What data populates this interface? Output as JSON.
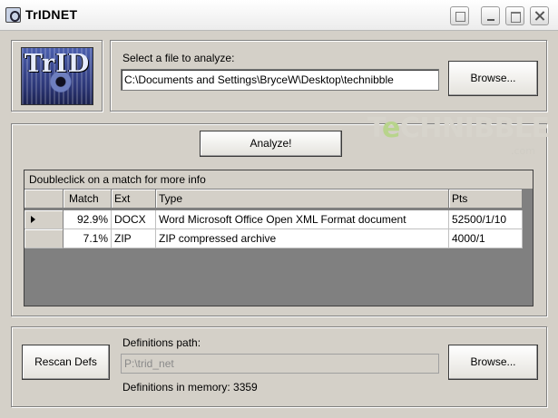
{
  "window": {
    "title": "TrIDNET"
  },
  "logo": {
    "text": "TrID"
  },
  "file": {
    "label": "Select a file to analyze:",
    "path": "C:\\Documents and Settings\\BryceW\\Desktop\\technibble",
    "browse_label": "Browse..."
  },
  "watermark": {
    "brand_prefix": "T",
    "brand_e": "e",
    "brand_rest": "CHNIBBLE",
    "suffix": ".com"
  },
  "analysis": {
    "analyze_label": "Analyze!",
    "caption": "Doubleclick on a match for more info",
    "columns": [
      "Match",
      "Ext",
      "Type",
      "Pts"
    ],
    "rows": [
      {
        "match": "92.9%",
        "ext": "DOCX",
        "type": "Word Microsoft Office Open XML Format document",
        "pts": "52500/1/10",
        "selected": true
      },
      {
        "match": "7.1%",
        "ext": "ZIP",
        "type": "ZIP compressed archive",
        "pts": "4000/1",
        "selected": false
      }
    ]
  },
  "definitions": {
    "rescan_label": "Rescan Defs",
    "path_label": "Definitions path:",
    "path_value": "P:\\trid_net",
    "browse_label": "Browse...",
    "memory_label": "Definitions in memory: 3359"
  },
  "colors": {
    "face": "#d4d0c8",
    "grid_bg": "#808080",
    "watermark_green": "#b8d48c"
  }
}
